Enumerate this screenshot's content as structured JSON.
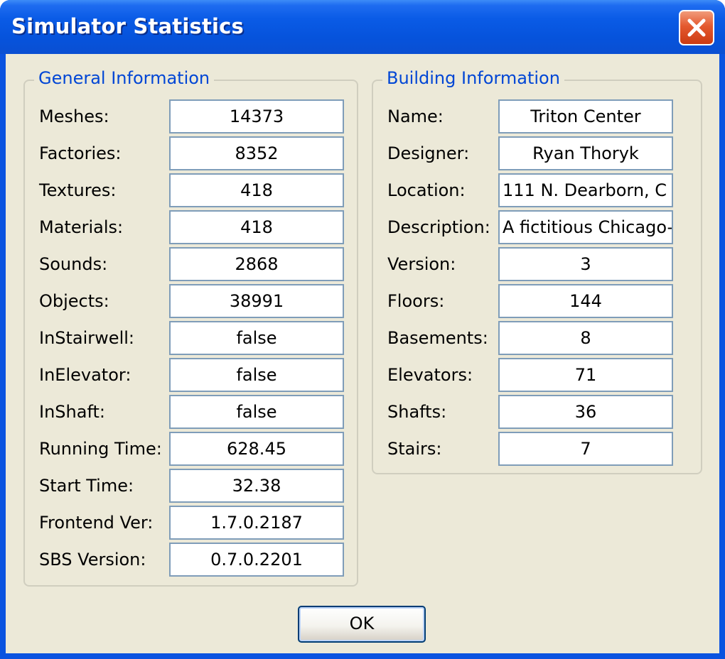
{
  "window": {
    "title": "Simulator Statistics",
    "close_icon": "close-icon"
  },
  "general": {
    "title": "General Information",
    "rows": [
      {
        "label": "Meshes:",
        "value": "14373"
      },
      {
        "label": "Factories:",
        "value": "8352"
      },
      {
        "label": "Textures:",
        "value": "418"
      },
      {
        "label": "Materials:",
        "value": "418"
      },
      {
        "label": "Sounds:",
        "value": "2868"
      },
      {
        "label": "Objects:",
        "value": "38991"
      },
      {
        "label": "InStairwell:",
        "value": "false"
      },
      {
        "label": "InElevator:",
        "value": "false"
      },
      {
        "label": "InShaft:",
        "value": "false"
      },
      {
        "label": "Running Time:",
        "value": "628.45"
      },
      {
        "label": "Start Time:",
        "value": "32.38"
      },
      {
        "label": "Frontend Ver:",
        "value": "1.7.0.2187"
      },
      {
        "label": "SBS Version:",
        "value": "0.7.0.2201"
      }
    ]
  },
  "building": {
    "title": "Building Information",
    "rows": [
      {
        "label": "Name:",
        "value": "Triton Center"
      },
      {
        "label": "Designer:",
        "value": "Ryan Thoryk"
      },
      {
        "label": "Location:",
        "value": "111 N. Dearborn, C"
      },
      {
        "label": "Description:",
        "value": "A fictitious Chicago-"
      },
      {
        "label": "Version:",
        "value": "3"
      },
      {
        "label": "Floors:",
        "value": "144"
      },
      {
        "label": "Basements:",
        "value": "8"
      },
      {
        "label": "Elevators:",
        "value": "71"
      },
      {
        "label": "Shafts:",
        "value": "36"
      },
      {
        "label": "Stairs:",
        "value": "7"
      }
    ]
  },
  "buttons": {
    "ok_label": "OK"
  },
  "colors": {
    "title_bar": "#0A53E0",
    "dialog_background": "#ECE9D8",
    "group_title": "#0046D5",
    "field_border": "#7F9DB9",
    "close_button": "#E4592F"
  }
}
